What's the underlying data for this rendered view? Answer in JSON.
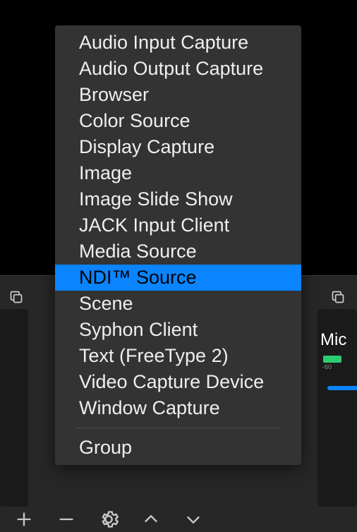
{
  "menu": {
    "items": [
      {
        "label": "Audio Input Capture",
        "selected": false
      },
      {
        "label": "Audio Output Capture",
        "selected": false
      },
      {
        "label": "Browser",
        "selected": false
      },
      {
        "label": "Color Source",
        "selected": false
      },
      {
        "label": "Display Capture",
        "selected": false
      },
      {
        "label": "Image",
        "selected": false
      },
      {
        "label": "Image Slide Show",
        "selected": false
      },
      {
        "label": "JACK Input Client",
        "selected": false
      },
      {
        "label": "Media Source",
        "selected": false
      },
      {
        "label": "NDI™ Source",
        "selected": true
      },
      {
        "label": "Scene",
        "selected": false
      },
      {
        "label": "Syphon Client",
        "selected": false
      },
      {
        "label": "Text (FreeType 2)",
        "selected": false
      },
      {
        "label": "Video Capture Device",
        "selected": false
      },
      {
        "label": "Window Capture",
        "selected": false
      }
    ],
    "footer": {
      "label": "Group"
    }
  },
  "mixer": {
    "channel_label": "Mic",
    "db_mark": "-60"
  }
}
